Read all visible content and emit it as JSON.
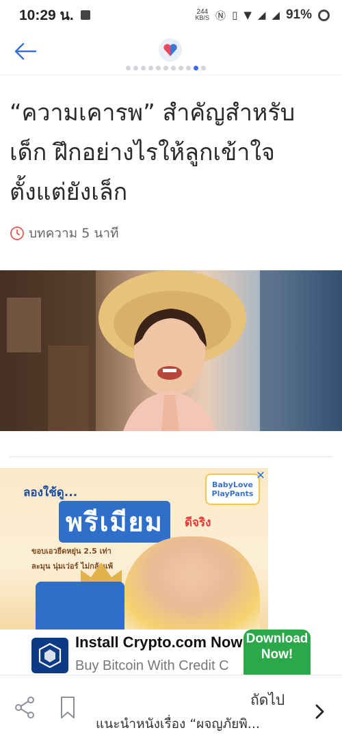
{
  "status_bar": {
    "time": "10:29 น.",
    "net_speed_value": "244",
    "net_speed_unit": "KB/S",
    "battery_percent": "91%"
  },
  "header": {
    "page_dots_total": 11,
    "page_dots_active_index": 9
  },
  "article": {
    "title": "“ความเคารพ” สำคัญสำหรับเด็ก ฝึกอย่างไรให้ลูกเข้าใจตั้งแต่ยังเล็ก",
    "read_time": "บทความ 5 นาที"
  },
  "ad": {
    "try_text": "ลองใช้ดู...",
    "premium_text": "พรีเมียม",
    "real_text": "ดีจริง",
    "brand_text": "BabyLove PlayPants",
    "bullet_1": "ขอบเอวยืดหยุ่น 2.5 เท่า",
    "bullet_2": "ละมุน นุ่มเว่อร์ ไม่กลัวแพ้",
    "close_label": "✕"
  },
  "install_banner": {
    "title": "Install Crypto.com Now",
    "subtitle": "Buy Bitcoin With Credit C",
    "button_label": "Download Now!"
  },
  "bottom_bar": {
    "next_label": "ถัดไป",
    "next_title": "แนะนำหนังเรื่อง “ผจญภัยพิ..."
  },
  "colors": {
    "accent": "#3b6fe0",
    "download_green": "#2ba84a",
    "clock_red": "#e0584f"
  }
}
